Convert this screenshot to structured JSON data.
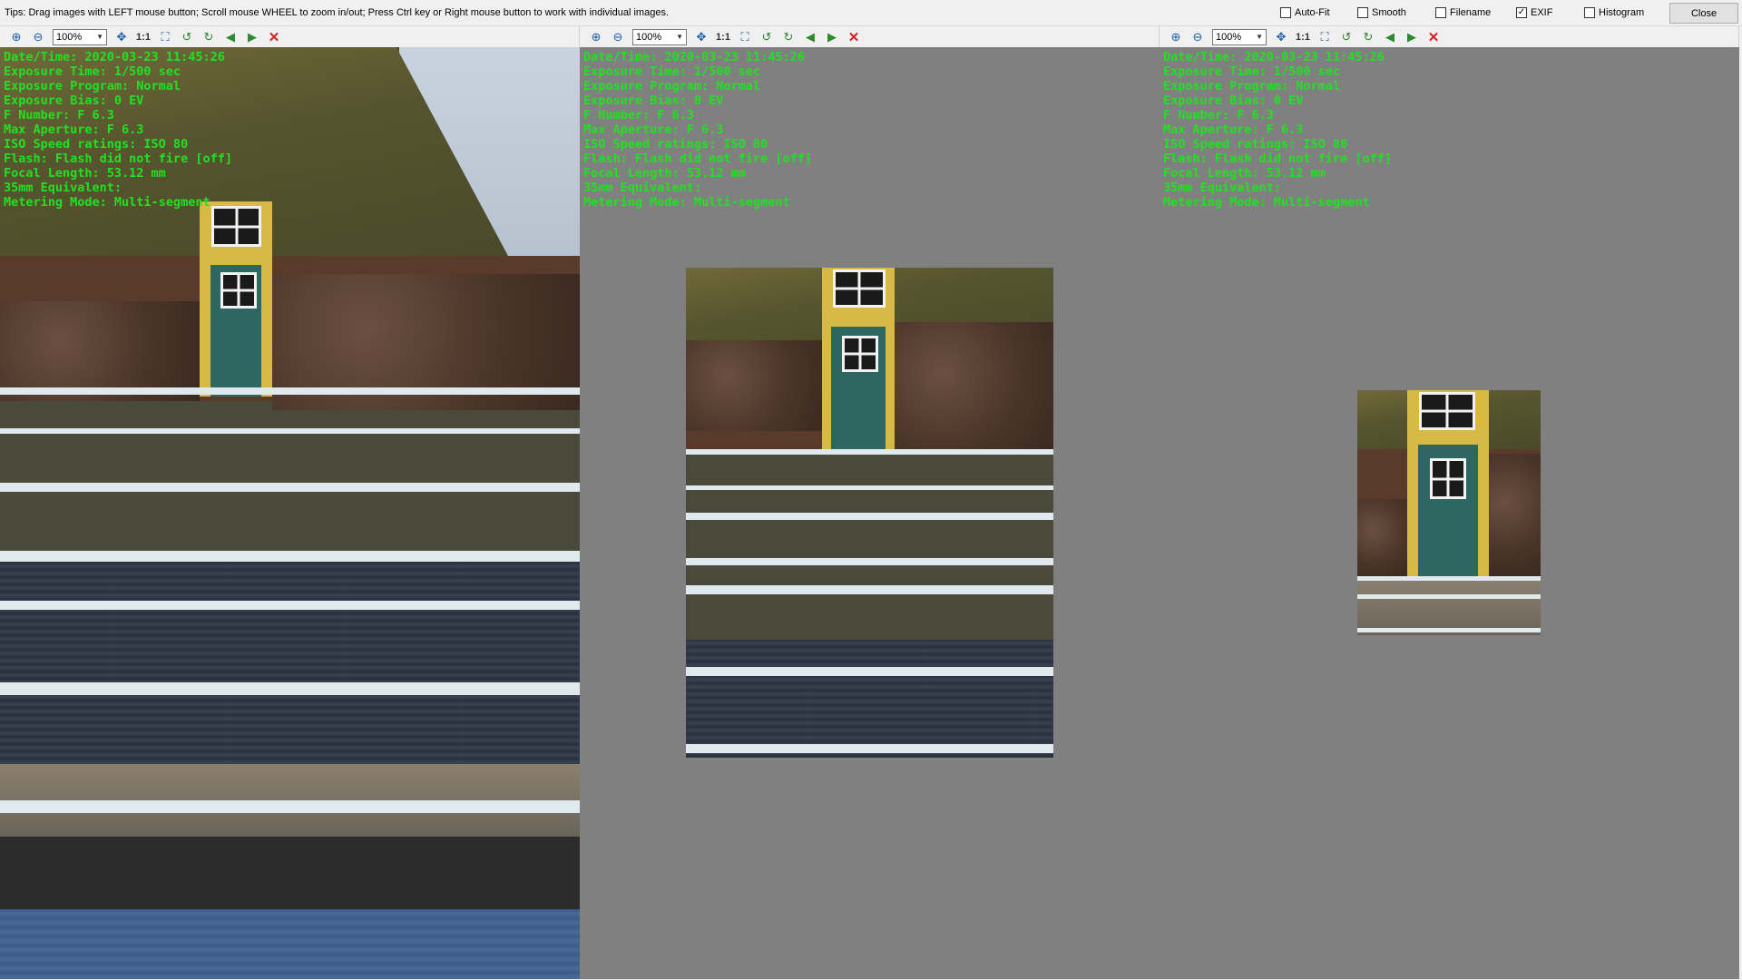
{
  "tips": "Tips: Drag images with LEFT mouse button; Scroll mouse WHEEL to zoom in/out; Press Ctrl key or Right mouse button to work with individual images.",
  "options": [
    {
      "label": "Auto-Fit",
      "checked": false
    },
    {
      "label": "Smooth",
      "checked": false
    },
    {
      "label": "Filename",
      "checked": false
    },
    {
      "label": "EXIF",
      "checked": true
    },
    {
      "label": "Histogram",
      "checked": false
    }
  ],
  "close_label": "Close",
  "pane_toolbar": {
    "zoom_value": "100%",
    "one_to_one": "1:1"
  },
  "icons": [
    "zoom-in-icon",
    "zoom-out-icon",
    "fit-icon",
    "one-to-one-icon",
    "fullscreen-icon",
    "rotate-left-icon",
    "rotate-right-icon",
    "prev-image-icon",
    "next-image-icon",
    "close-image-icon"
  ],
  "exif_lines": [
    "Date/Time: 2020-03-23 11:45:26",
    "Exposure Time: 1/500 sec",
    "Exposure Program: Normal",
    "Exposure Bias: 0 EV",
    "F Number: F 6.3",
    "Max Aperture: F 6.3",
    "ISO Speed ratings: ISO 80",
    "Flash: Flash did not fire [off]",
    "Focal Length: 53.12 mm",
    "35mm Equivalent:",
    "Metering Mode: Multi-segment"
  ],
  "colors": {
    "exif_text": "#22e022",
    "viewport_bg": "#808080",
    "close_red": "#d42020"
  }
}
